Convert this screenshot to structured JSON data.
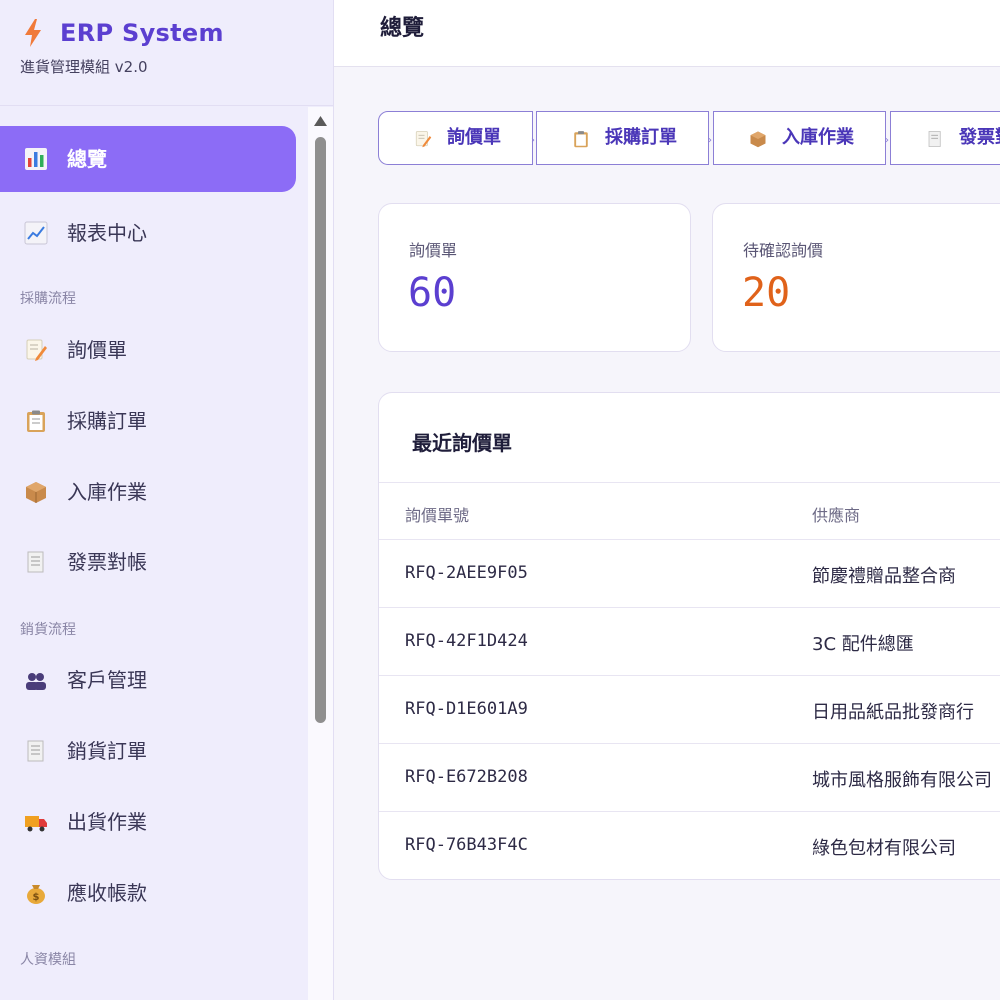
{
  "brand": {
    "title": "ERP System",
    "subtitle": "進貨管理模組 v2.0",
    "accent": "#5b3fd0"
  },
  "sidebar": {
    "top_items": [
      {
        "label": "總覽",
        "icon": "bar-chart-icon",
        "active": true
      },
      {
        "label": "報表中心",
        "icon": "line-chart-icon"
      }
    ],
    "sections": [
      {
        "title": "採購流程",
        "items": [
          {
            "label": "詢價單",
            "icon": "memo-icon"
          },
          {
            "label": "採購訂單",
            "icon": "clipboard-icon"
          },
          {
            "label": "入庫作業",
            "icon": "package-icon"
          },
          {
            "label": "發票對帳",
            "icon": "receipt-icon"
          }
        ]
      },
      {
        "title": "銷貨流程",
        "items": [
          {
            "label": "客戶管理",
            "icon": "users-icon"
          },
          {
            "label": "銷貨訂單",
            "icon": "receipt-icon"
          },
          {
            "label": "出貨作業",
            "icon": "truck-icon"
          },
          {
            "label": "應收帳款",
            "icon": "money-bag-icon"
          }
        ]
      },
      {
        "title": "人資模組",
        "items": []
      }
    ],
    "active_color": "#8c6cf6"
  },
  "header": {
    "title": "總覽"
  },
  "workflow_steps": [
    {
      "label": "詢價單",
      "icon": "memo-icon"
    },
    {
      "label": "採購訂單",
      "icon": "clipboard-icon"
    },
    {
      "label": "入庫作業",
      "icon": "package-icon"
    },
    {
      "label": "發票對",
      "icon": "receipt-icon"
    }
  ],
  "stats": [
    {
      "label": "詢價單",
      "value": "60",
      "color": "#5b3fd0"
    },
    {
      "label": "待確認詢價",
      "value": "20",
      "color": "#e0621a"
    }
  ],
  "recent_rfq": {
    "title": "最近詢價單",
    "columns": [
      "詢價單號",
      "供應商"
    ],
    "rows": [
      {
        "id": "RFQ-2AEE9F05",
        "supplier": "節慶禮贈品整合商"
      },
      {
        "id": "RFQ-42F1D424",
        "supplier": "3C 配件總匯"
      },
      {
        "id": "RFQ-D1E601A9",
        "supplier": "日用品紙品批發商行"
      },
      {
        "id": "RFQ-E672B208",
        "supplier": "城市風格服飾有限公司"
      },
      {
        "id": "RFQ-76B43F4C",
        "supplier": "綠色包材有限公司"
      }
    ]
  }
}
